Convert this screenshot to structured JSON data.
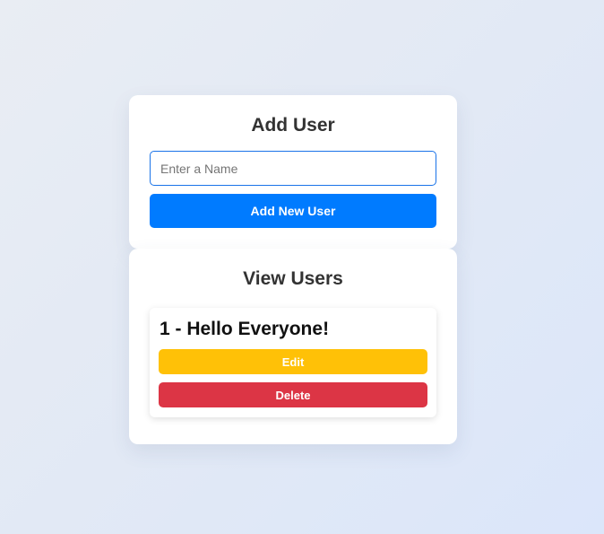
{
  "add_user": {
    "title": "Add User",
    "name_input": {
      "value": "",
      "placeholder": "Enter a Name"
    },
    "submit_label": "Add New User"
  },
  "view_users": {
    "title": "View Users",
    "users": [
      {
        "display": "1 - Hello Everyone!",
        "edit_label": "Edit",
        "delete_label": "Delete"
      }
    ]
  },
  "colors": {
    "primary": "#007bff",
    "edit": "#ffc107",
    "delete": "#dc3545",
    "input_border": "#1a73e8"
  }
}
